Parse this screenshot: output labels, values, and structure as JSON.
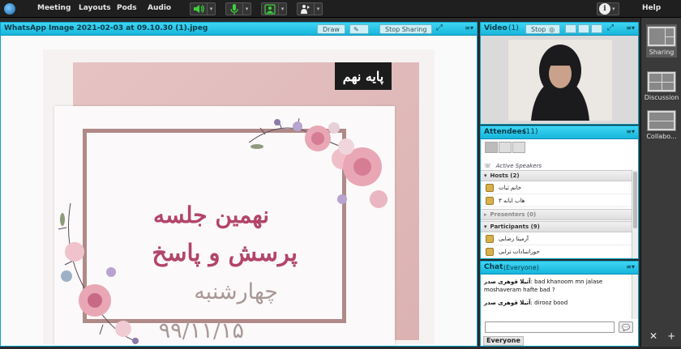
{
  "topbar": {
    "menus": [
      "Meeting",
      "Layouts",
      "Pods",
      "Audio"
    ],
    "help": "Help",
    "info_caret": "▾",
    "colors": {
      "accent": "#3ed13e",
      "bar": "#1f1f1f"
    }
  },
  "share": {
    "title": "WhatsApp Image 2021-02-03 at 09.10.30 (1).jpeg",
    "draw_label": "Draw",
    "stop_label": "Stop Sharing",
    "slide": {
      "stamp": "پایه نهم",
      "line1": "نهمین جلسه",
      "line2": "پرسش و پاسخ",
      "line3": "چهارشنبه",
      "line4": "۹۹/۱۱/۱۵"
    }
  },
  "video": {
    "title": "Video",
    "count": "(1)",
    "stop_label": "Stop"
  },
  "attendees": {
    "title": "Attendees",
    "count": "(11)",
    "active_speakers": "Active Speakers",
    "sections": [
      {
        "label": "Hosts (2)",
        "people": [
          "خانم ثبات",
          "هاب ابانه ۳"
        ]
      },
      {
        "label": "Presenters (0)",
        "people": []
      },
      {
        "label": "Participants (9)",
        "people": [
          "آرمیتا رضایی",
          "حوراسادات ترابی"
        ]
      }
    ]
  },
  "chat": {
    "title": "Chat",
    "scope": "(Everyone)",
    "messages": [
      {
        "from": "آتیلا قوهری صدر",
        "text": "bad khanoom mn jalase moshaveram hafte bad ?"
      },
      {
        "from": "آتیلا قوهری صدر",
        "text": "dirooz bood"
      }
    ],
    "tab": "Everyone"
  },
  "layouts": [
    {
      "label": "Sharing"
    },
    {
      "label": "Discussion"
    },
    {
      "label": "Collabo..."
    }
  ]
}
